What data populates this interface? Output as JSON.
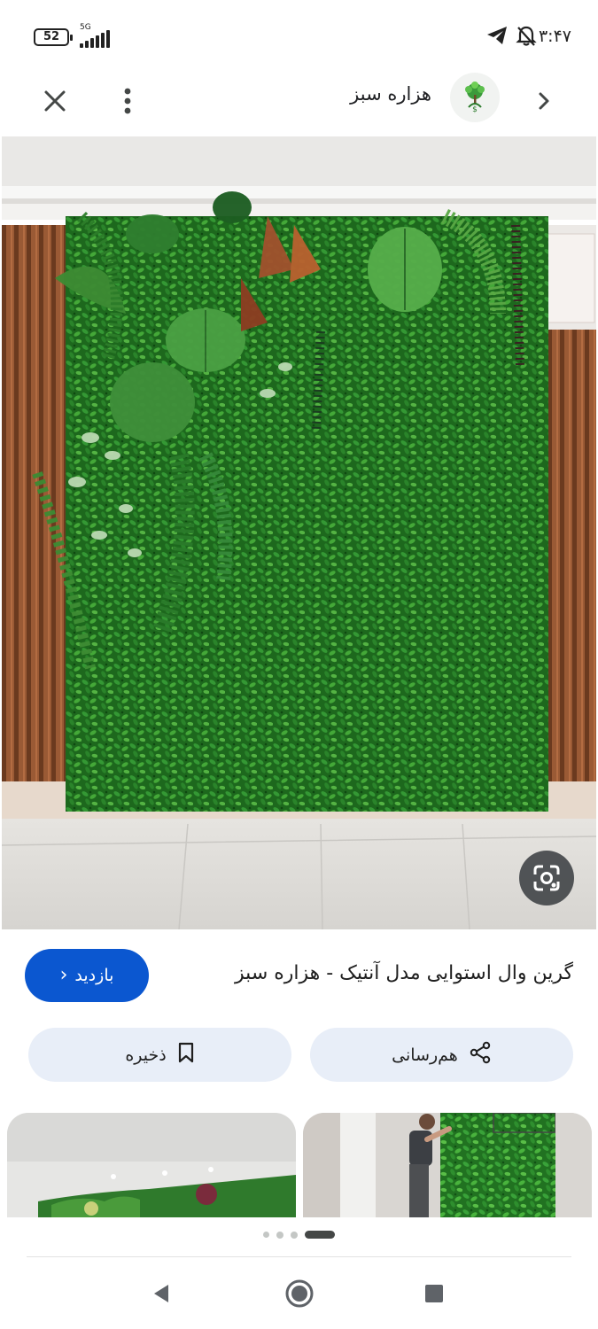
{
  "status_bar": {
    "battery": "52",
    "network": "5G",
    "time": "۳:۴۷"
  },
  "header": {
    "site_name": "هزاره سبز",
    "icons": [
      "close-icon",
      "more-vert-icon",
      "site-logo",
      "chevron-right-icon"
    ]
  },
  "image": {
    "title": "گرین وال استوایی مدل آنتیک - هزاره سبز",
    "lens_icon": "google-lens-icon"
  },
  "actions": {
    "visit_label": "بازدید",
    "share_label": "هم‌رسانی",
    "save_label": "ذخیره"
  },
  "carousel": {
    "page_count": 4,
    "active_index": 3
  },
  "nav": {
    "icons": [
      "back-triangle-icon",
      "home-circle-icon",
      "recents-square-icon"
    ]
  },
  "colors": {
    "accent": "#0b57d0",
    "chip_bg": "#e8eef8",
    "lens_bg": "#3c4043"
  }
}
